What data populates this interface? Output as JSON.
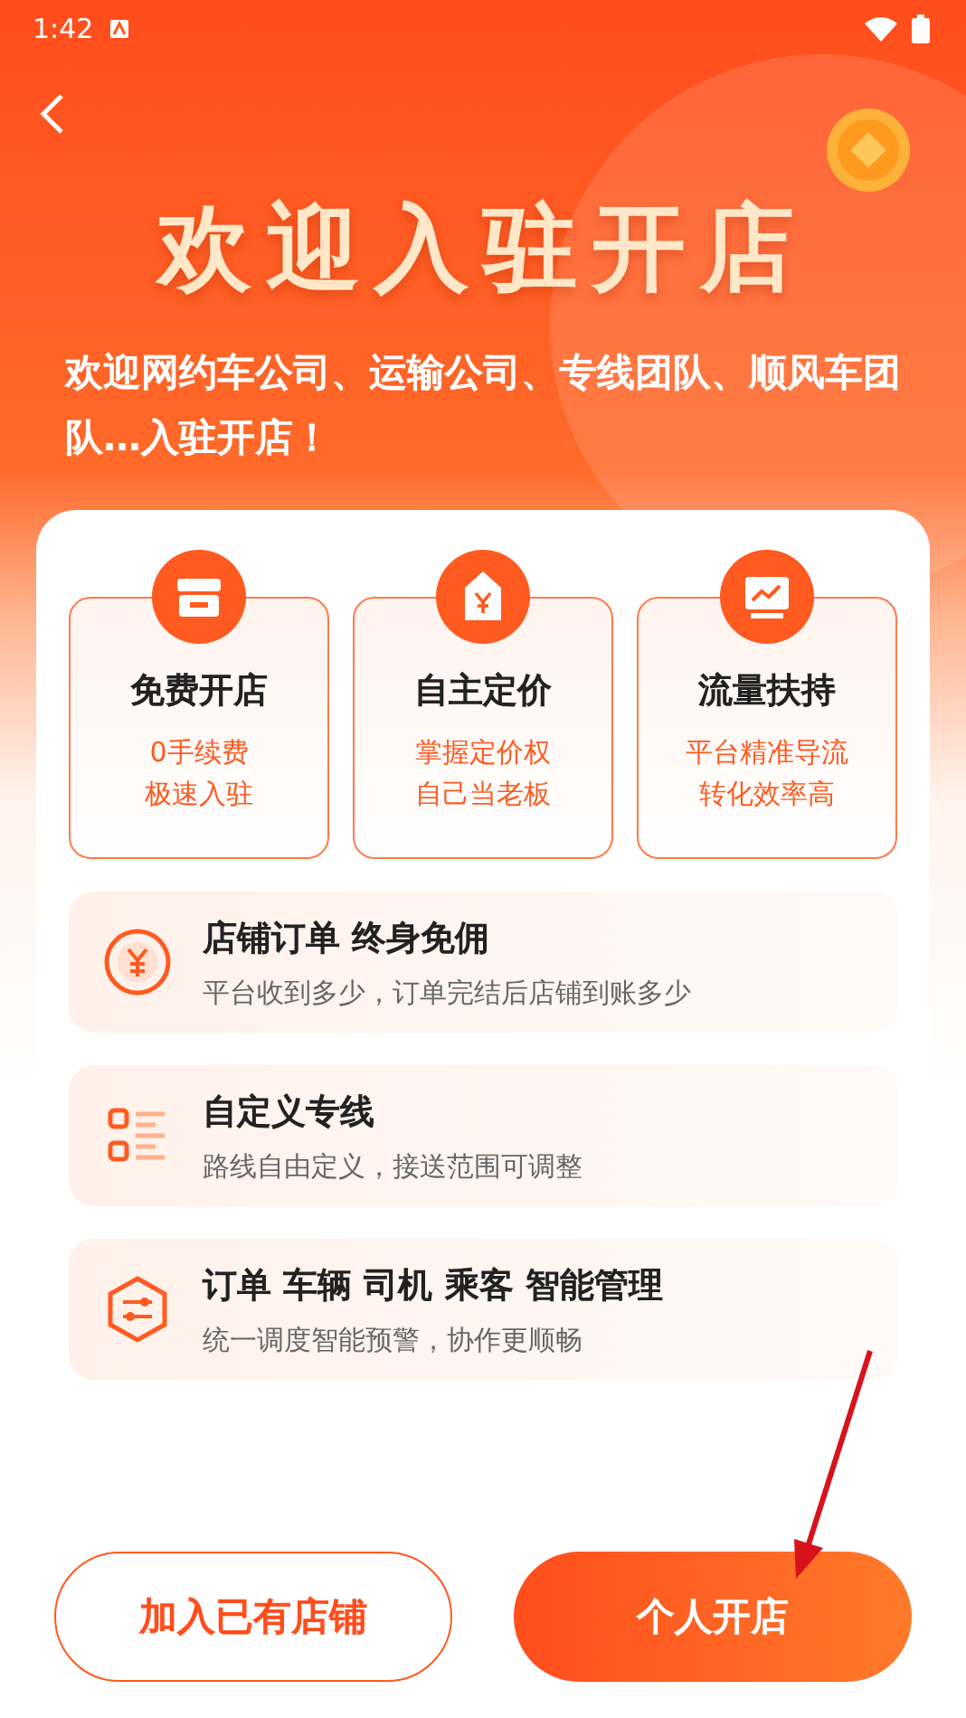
{
  "status_bar": {
    "time": "1:42"
  },
  "hero": {
    "title": "欢迎入驻开店",
    "subtitle": "欢迎网约车公司、运输公司、专线团队、顺风车团队…入驻开店！"
  },
  "features": [
    {
      "kind": "store",
      "title": "免费开店",
      "lines": [
        "0手续费",
        "极速入驻"
      ]
    },
    {
      "kind": "price",
      "title": "自主定价",
      "lines": [
        "掌握定价权",
        "自己当老板"
      ]
    },
    {
      "kind": "chart",
      "title": "流量扶持",
      "lines": [
        "平台精准导流",
        "转化效率高"
      ]
    }
  ],
  "benefits": [
    {
      "kind": "yen",
      "title": "店铺订单 终身免佣",
      "desc": "平台收到多少，订单完结后店铺到账多少"
    },
    {
      "kind": "lines",
      "title": "自定义专线",
      "desc": "路线自由定义，接送范围可调整"
    },
    {
      "kind": "hex",
      "title": "订单 车辆 司机 乘客 智能管理",
      "desc": "统一调度智能预警，协作更顺畅"
    }
  ],
  "buttons": [
    {
      "kind": "outline",
      "label": "加入已有店铺"
    },
    {
      "kind": "primary",
      "label": "个人开店"
    }
  ]
}
